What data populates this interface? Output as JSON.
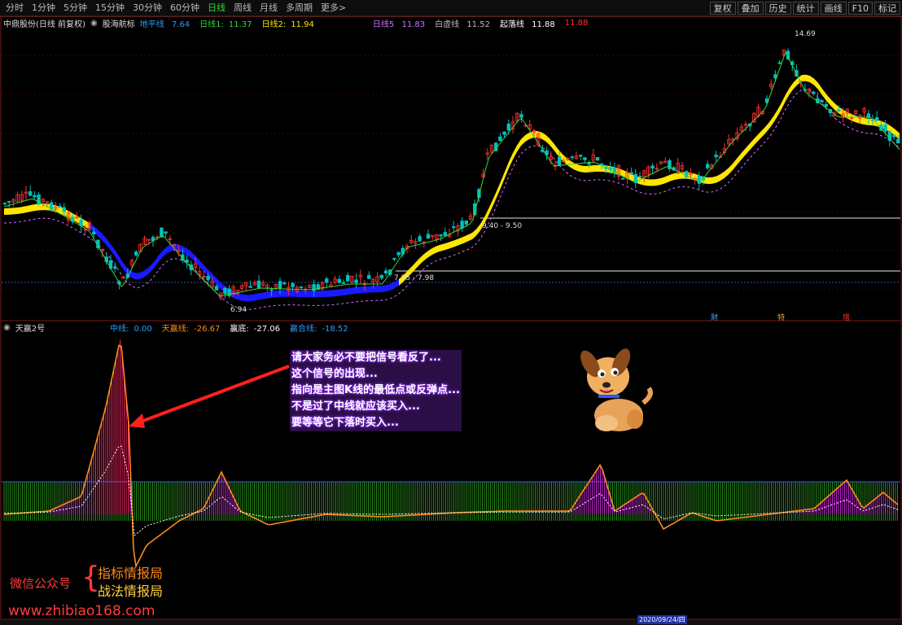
{
  "toolbar": {
    "tabs": [
      "分时",
      "1分钟",
      "5分钟",
      "15分钟",
      "30分钟",
      "60分钟",
      "日线",
      "周线",
      "月线",
      "多周期",
      "更多>"
    ],
    "active_tab": "日线",
    "right_buttons": [
      "复权",
      "叠加",
      "历史",
      "统计",
      "画线",
      "F10",
      "标记"
    ]
  },
  "main_legend": {
    "stock": "中鼎股份(日线 前复权)",
    "indicator": "股海航标",
    "items": [
      {
        "label": "地平线",
        "value": "7.64",
        "color": "#2a9bff"
      },
      {
        "label": "日线1:",
        "value": "11.37",
        "color": "#3ad33a"
      },
      {
        "label": "日线2:",
        "value": "11.94",
        "color": "#ffe600"
      },
      {
        "label": "日线5",
        "value": "11.83",
        "color": "#d070ff"
      },
      {
        "label": "白虚线",
        "value": "11.52",
        "color": "#bbbbbb"
      },
      {
        "label": "起落线",
        "value": "11.88",
        "color": "#ffffff"
      },
      {
        "label": "",
        "value": "11.88",
        "color": "#ff3030"
      }
    ]
  },
  "price_labels": {
    "high": "14.69",
    "low": "6.94",
    "range1": "7.95 - 7.98",
    "range2": "9.40 - 9.50"
  },
  "markers": {
    "m1": "财",
    "m2": "特",
    "m3": "增"
  },
  "sub_legend": {
    "indicator": "天赢2号",
    "items": [
      {
        "label": "中线:",
        "value": "0.00",
        "color": "#2a9bff"
      },
      {
        "label": "天赢线:",
        "value": "-26.67",
        "color": "#ff8a1a"
      },
      {
        "label": "赢底:",
        "value": "-27.06",
        "color": "#ffffff"
      },
      {
        "label": "赢合线:",
        "value": "-18.52",
        "color": "#2a9bff"
      }
    ]
  },
  "annotation": [
    "请大家务必不要把信号看反了...",
    "这个信号的出现...",
    "指向是主图K线的最低点或反弹点...",
    "不是过了中线就应该买入...",
    "要等等它下落时买入..."
  ],
  "watermark": {
    "wechat": "微信公众号",
    "brace": "{",
    "line1": "指标情报局",
    "line2": "战法情报局",
    "url": "www.zhibiao168.com"
  },
  "timeline": {
    "date": "2020/09/24/四"
  },
  "colors": {
    "up": "#ff3030",
    "down": "#00c0c0",
    "ma_yellow": "#ffe600",
    "ma_blue": "#1a1aff"
  }
}
